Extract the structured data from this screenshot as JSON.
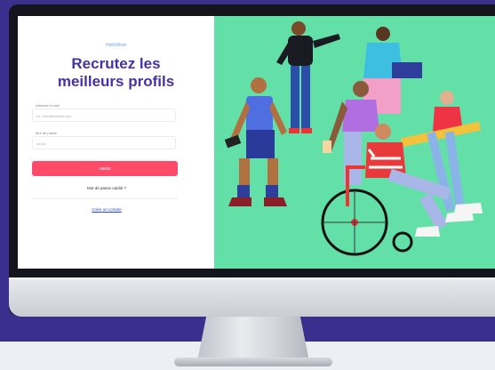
{
  "login": {
    "brand": "HelloWork",
    "headline_line1": "Recrutez les",
    "headline_line2": "meilleurs profils",
    "email_label": "Adresse e-mail",
    "email_placeholder": "ex: nom@société.com",
    "password_label": "Mot de passe",
    "password_placeholder": "••••••••",
    "login_button": "Valider",
    "forgot_link": "Mot de passe oublié ?",
    "create_account_link": "Créer un compte"
  },
  "colors": {
    "background": "#3a2f8c",
    "headline": "#4433a8",
    "button": "#ff4a6a",
    "illustration_bg": "#62e0a8"
  },
  "illustration": {
    "description_icons": [
      "people-illustration"
    ]
  }
}
